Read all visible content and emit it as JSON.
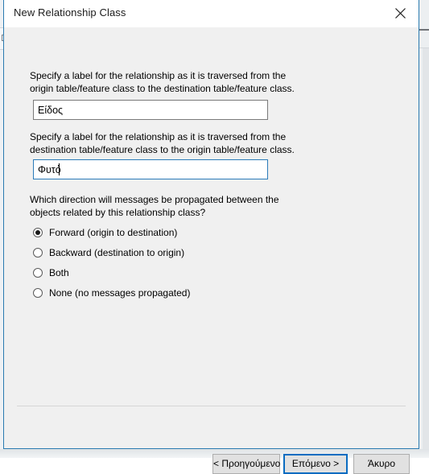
{
  "dialog": {
    "title": "New Relationship Class",
    "close_icon": "close-icon"
  },
  "body": {
    "paragraph_1": "Specify a label for the relationship as it is traversed from the\norigin table/feature class to the destination table/feature class.",
    "paragraph_2": "Specify a label for the relationship as it is traversed from the\ndestination table/feature class to the origin table/feature class.",
    "paragraph_3": "Which direction will messages be propagated between the\nobjects related by this relationship class?"
  },
  "fields": {
    "forward_label": {
      "value": "Είδος",
      "placeholder": "",
      "focused": false
    },
    "backward_label": {
      "value": "Φυτό",
      "placeholder": "",
      "focused": true
    }
  },
  "direction_options": [
    {
      "label": "Forward (origin to destination)",
      "selected": true
    },
    {
      "label": "Backward (destination to origin)",
      "selected": false
    },
    {
      "label": "Both",
      "selected": false
    },
    {
      "label": "None (no messages propagated)",
      "selected": false
    }
  ],
  "buttons": {
    "back": "< Προηγούμενο",
    "next": "Επόμενο >",
    "cancel": "Άκυρο"
  },
  "colors": {
    "dialog_border": "#2a7ab0",
    "default_button_border": "#0a6cc1",
    "focused_field_border": "#2b7bb9",
    "dialog_background": "#f0f0f0",
    "titlebar_background": "#ffffff"
  }
}
